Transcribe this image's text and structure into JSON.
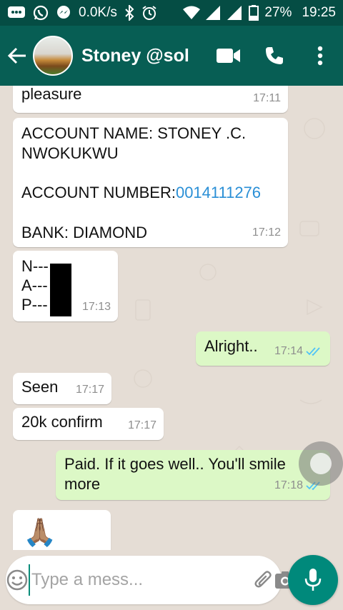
{
  "status_bar": {
    "network_speed": "0.0K/s",
    "battery": "27%",
    "clock": "19:25"
  },
  "header": {
    "title": "Stoney @sol"
  },
  "messages": [
    {
      "text": "pleasure",
      "time": "17:11"
    },
    {
      "text": "ACCOUNT NAME: STONEY .C.\nNWOKUKWU",
      "account_number_label": "ACCOUNT NUMBER:",
      "account_number": "0014111276",
      "bank": "BANK: DIAMOND",
      "time": "17:12"
    },
    {
      "lines": [
        "N---",
        "A---",
        "P---"
      ],
      "time": "17:13"
    },
    {
      "text": "Alright..",
      "time": "17:14"
    },
    {
      "text": "Seen",
      "time": "17:17"
    },
    {
      "text": "20k confirm",
      "time": "17:17"
    },
    {
      "text": "Paid. If it goes well.. You'll smile\nmore",
      "time": "17:18"
    },
    {
      "emoji": "🙏🏽"
    }
  ],
  "input": {
    "placeholder": "Type a mess..."
  },
  "colors": {
    "status_bar": "#054d44",
    "app_bar": "#075e54",
    "outgoing_bubble": "#dcf8c6",
    "incoming_bubble": "#ffffff",
    "mic_button": "#00897b",
    "read_ticks": "#4fc3f7"
  }
}
